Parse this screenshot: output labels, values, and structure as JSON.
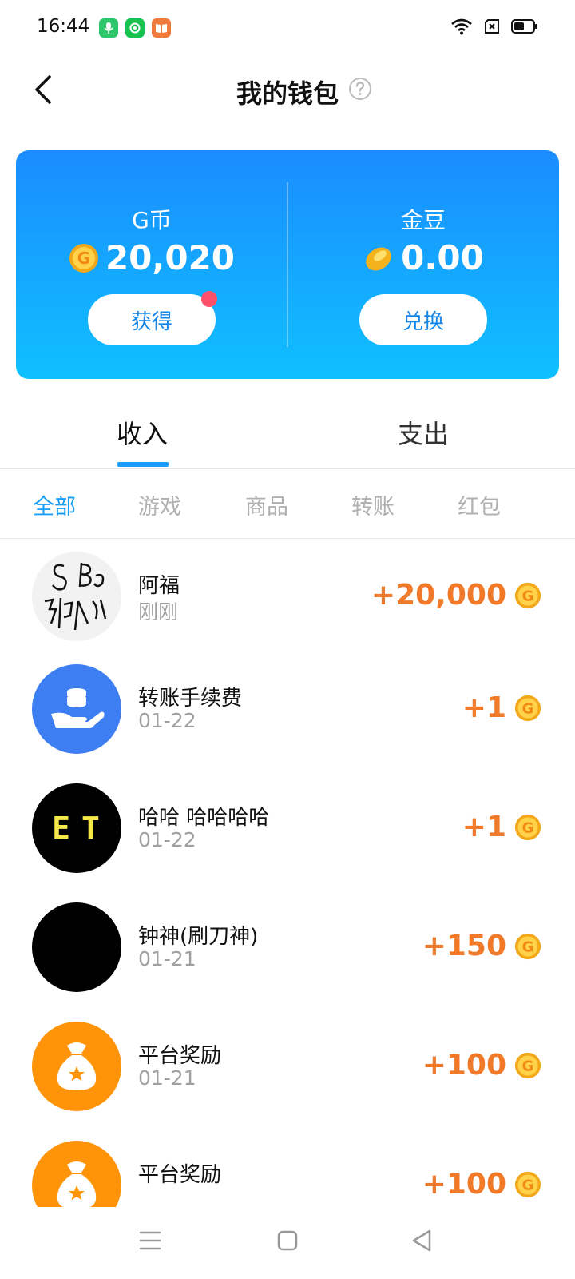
{
  "status_bar": {
    "time": "16:44",
    "app_icons": [
      "microphone-app-icon",
      "camera-app-icon",
      "book-app-icon"
    ],
    "right_icons": [
      "wifi-icon",
      "sim-icon",
      "battery-icon"
    ]
  },
  "header": {
    "title": "我的钱包",
    "help_icon": "question-icon"
  },
  "wallet": {
    "gcoin": {
      "label": "G币",
      "amount": "20,020",
      "button": "获得",
      "has_badge": true
    },
    "bean": {
      "label": "金豆",
      "amount": "0.00",
      "button": "兑换"
    }
  },
  "tabs": {
    "items": [
      "收入",
      "支出"
    ],
    "active": "收入"
  },
  "filters": {
    "items": [
      "全部",
      "游戏",
      "商品",
      "转账",
      "红包"
    ],
    "active": "全部"
  },
  "transactions": [
    {
      "name": "阿福",
      "date": "刚刚",
      "amount": "+20,000"
    },
    {
      "name": "转账手续费",
      "date": "01-22",
      "amount": "+1"
    },
    {
      "name": "哈哈 哈哈哈哈",
      "date": "01-22",
      "amount": "+1",
      "avatar_text": "ET"
    },
    {
      "name": "钟神(刷刀神)",
      "date": "01-21",
      "amount": "+150"
    },
    {
      "name": "平台奖励",
      "date": "01-21",
      "amount": "+100"
    },
    {
      "name": "平台奖励",
      "date": "",
      "amount": "+100"
    }
  ],
  "colors": {
    "accent": "#1a9df5",
    "amount": "#f07a2a",
    "card_top": "#1a8cff",
    "card_bottom": "#0fc0ff"
  }
}
